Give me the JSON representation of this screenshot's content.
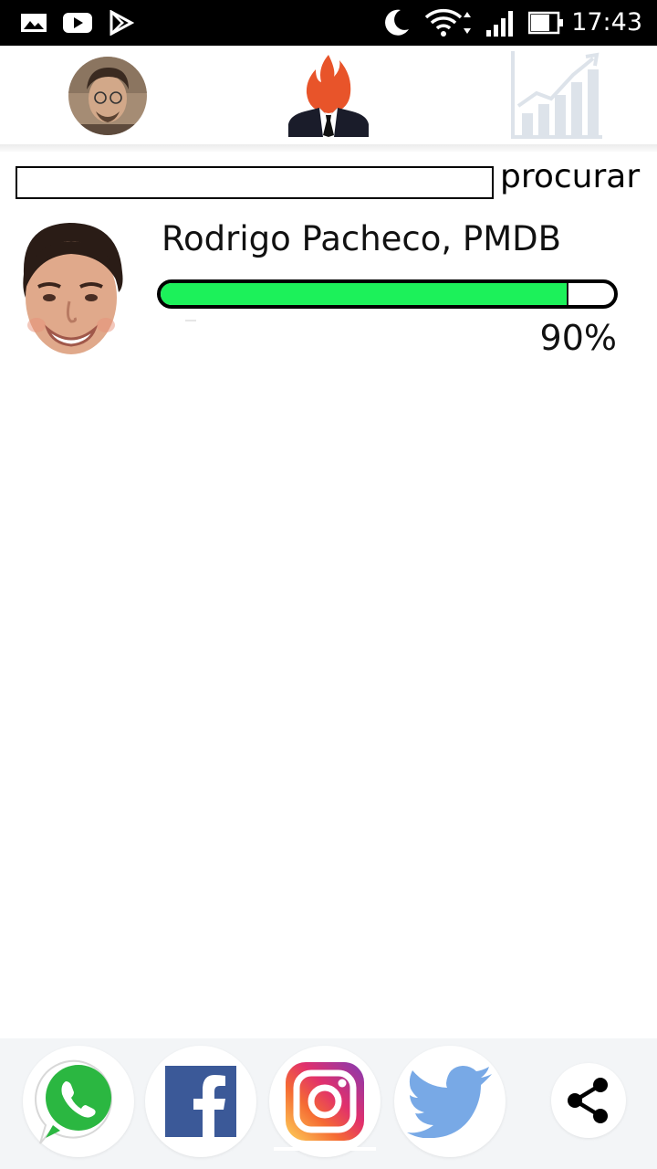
{
  "status_bar": {
    "time": "17:43",
    "icons": [
      "gallery-icon",
      "youtube-icon",
      "play-store-icon",
      "moon-icon",
      "wifi-icon",
      "signal-icon",
      "battery-icon"
    ]
  },
  "top_nav": {
    "items": [
      {
        "icon": "user-avatar"
      },
      {
        "icon": "candidate-flame-icon"
      },
      {
        "icon": "bar-chart-icon"
      }
    ]
  },
  "search": {
    "value": "",
    "placeholder": "",
    "label": "procurar"
  },
  "candidates": [
    {
      "name": "Rodrigo Pacheco, PMDB",
      "percent_value": 90,
      "percent_label": "90%"
    }
  ],
  "share_bar": {
    "items": [
      "whatsapp-icon",
      "facebook-icon",
      "instagram-icon",
      "twitter-icon",
      "share-icon"
    ]
  },
  "colors": {
    "progress_fill": "#1cf15a",
    "flame": "#e8542a",
    "facebook": "#3b5998",
    "twitter": "#55acee",
    "whatsapp": "#25d366"
  }
}
